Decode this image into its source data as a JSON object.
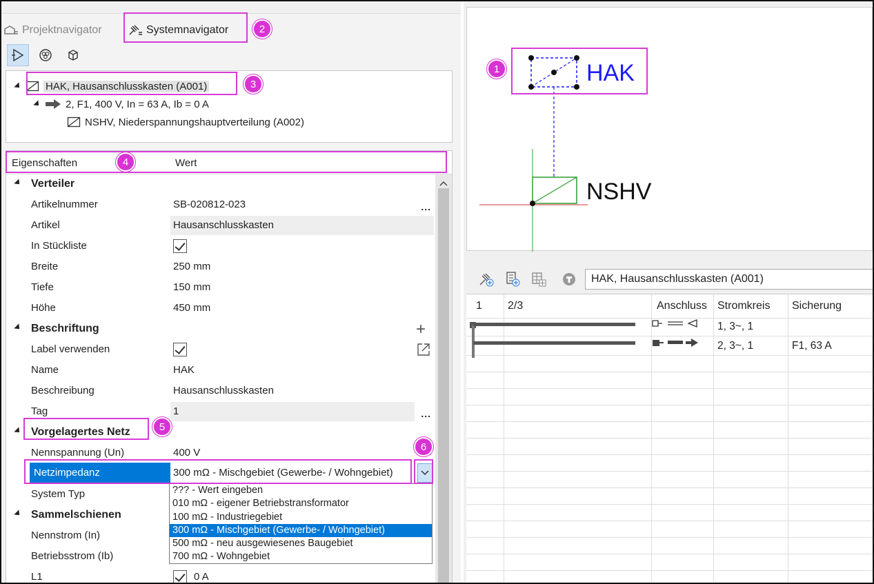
{
  "left_tabs": {
    "projekt": "Projektnavigator",
    "system": "Systemnavigator"
  },
  "tree": {
    "node1": "HAK, Hausanschlusskasten (A001)",
    "node2": "2, F1, 400 V, In = 63 A, Ib = 0 A",
    "node3": "NSHV, Niederspannungshauptverteilung (A002)"
  },
  "props_header": {
    "name": "Eigenschaften",
    "value": "Wert"
  },
  "verteiler": {
    "title": "Verteiler",
    "artikelnummer_label": "Artikelnummer",
    "artikelnummer_value": "SB-020812-023",
    "artikel_label": "Artikel",
    "artikel_value": "Hausanschlusskasten",
    "stueckliste_label": "In Stückliste",
    "breite_label": "Breite",
    "breite_value": "250 mm",
    "tiefe_label": "Tiefe",
    "tiefe_value": "150 mm",
    "hoehe_label": "Höhe",
    "hoehe_value": "450 mm"
  },
  "beschriftung": {
    "title": "Beschriftung",
    "label_label": "Label verwenden",
    "name_label": "Name",
    "name_value": "HAK",
    "beschreibung_label": "Beschreibung",
    "beschreibung_value": "Hausanschlusskasten",
    "tag_label": "Tag",
    "tag_value": "1"
  },
  "netz": {
    "title": "Vorgelagertes Netz",
    "nennspannung_label": "Nennspannung (Un)",
    "nennspannung_value": "400 V",
    "netzimpedanz_label": "Netzimpedanz",
    "netzimpedanz_value": "300 mΩ - Mischgebiet (Gewerbe- / Wohngebiet)",
    "systemtyp_label": "System Typ"
  },
  "sammelschienen": {
    "title": "Sammelschienen",
    "nennstrom_label": "Nennstrom (In)",
    "betriebsstrom_label": "Betriebsstrom (Ib)",
    "l1_label": "L1",
    "l1_value": "0 A"
  },
  "dropdown_options": [
    "??? - Wert eingeben",
    "010 mΩ - eigener Betriebstransformator",
    "100 mΩ - Industriegebiet",
    "300 mΩ - Mischgebiet (Gewerbe- / Wohngebiet)",
    "500 mΩ - neu ausgewiesenes Baugebiet",
    "700 mΩ - Wohngebiet"
  ],
  "dropdown_selected_index": 3,
  "canvas": {
    "hak_label": "HAK",
    "nshv_label": "NSHV"
  },
  "right_toolbar": {
    "field_value": "HAK, Hausanschlusskasten (A001)"
  },
  "grid": {
    "headers": [
      "1",
      "2/3",
      "Anschluss",
      "Stromkreis",
      "Sicherung"
    ],
    "rows": [
      {
        "stromkreis": "1, 3~, 1",
        "sicherung": ""
      },
      {
        "stromkreis": "2, 3~, 1",
        "sicherung": "F1, 63 A"
      }
    ]
  },
  "badges": [
    "1",
    "2",
    "3",
    "4",
    "5",
    "6"
  ],
  "colors": {
    "highlight": "#d63bd6",
    "selection": "#0078d7",
    "diagram_blue": "#1a1aff",
    "diagram_green": "#2e9b2e"
  }
}
